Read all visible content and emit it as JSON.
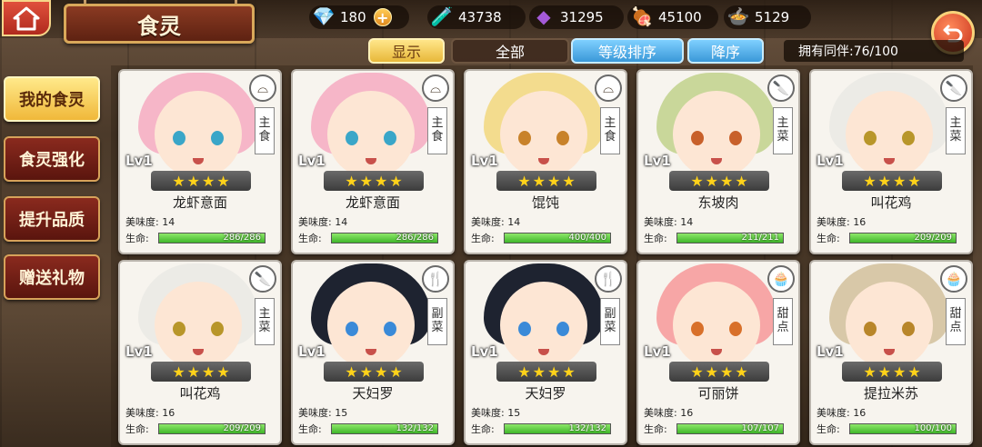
{
  "header": {
    "title": "食灵",
    "resources": [
      {
        "icon": "diamond-icon",
        "value": "180",
        "has_plus": true
      },
      {
        "icon": "potion-bottle-icon",
        "value": "43738",
        "has_plus": false
      },
      {
        "icon": "purple-gem-icon",
        "value": "31295",
        "has_plus": false
      },
      {
        "icon": "meat-icon",
        "value": "45100",
        "has_plus": false
      },
      {
        "icon": "cooking-pot-icon",
        "value": "5129",
        "has_plus": false
      }
    ]
  },
  "filters": {
    "show": "显示",
    "all": "全部",
    "sort": "等级排序",
    "order": "降序",
    "owned": "拥有同伴:76/100"
  },
  "sidebar": {
    "items": [
      {
        "label": "我的食灵",
        "active": true
      },
      {
        "label": "食灵强化",
        "active": false
      },
      {
        "label": "提升品质",
        "active": false
      },
      {
        "label": "赠送礼物",
        "active": false
      }
    ]
  },
  "labels": {
    "taste": "美味度:",
    "life": "生命:",
    "level": "Lv1"
  },
  "cards": [
    {
      "name": "龙虾意面",
      "category": [
        "主",
        "食"
      ],
      "badge": "bowl-icon",
      "taste": "14",
      "hp": "286/286",
      "hp_fraction": 1.0,
      "stars": 4,
      "hair": "#f6b6c8",
      "eye": "#3aa6c8"
    },
    {
      "name": "龙虾意面",
      "category": [
        "主",
        "食"
      ],
      "badge": "bowl-icon",
      "taste": "14",
      "hp": "286/286",
      "hp_fraction": 1.0,
      "stars": 4,
      "hair": "#f6b6c8",
      "eye": "#3aa6c8"
    },
    {
      "name": "馄饨",
      "category": [
        "主",
        "食"
      ],
      "badge": "bowl-icon",
      "taste": "14",
      "hp": "400/400",
      "hp_fraction": 1.0,
      "stars": 4,
      "hair": "#f3dc8e",
      "eye": "#c8822a"
    },
    {
      "name": "东坡肉",
      "category": [
        "主",
        "菜"
      ],
      "badge": "cleaver-icon",
      "taste": "14",
      "hp": "211/211",
      "hp_fraction": 1.0,
      "stars": 4,
      "hair": "#c9d79a",
      "eye": "#c8602a"
    },
    {
      "name": "叫花鸡",
      "category": [
        "主",
        "菜"
      ],
      "badge": "cleaver-icon",
      "taste": "16",
      "hp": "209/209",
      "hp_fraction": 1.0,
      "stars": 4,
      "hair": "#ecebe6",
      "eye": "#b8962a"
    },
    {
      "name": "叫花鸡",
      "category": [
        "主",
        "菜"
      ],
      "badge": "cleaver-icon",
      "taste": "16",
      "hp": "209/209",
      "hp_fraction": 1.0,
      "stars": 4,
      "hair": "#ecebe6",
      "eye": "#b8962a"
    },
    {
      "name": "天妇罗",
      "category": [
        "副",
        "菜"
      ],
      "badge": "fork-icon",
      "taste": "15",
      "hp": "132/132",
      "hp_fraction": 1.0,
      "stars": 4,
      "hair": "#1e2330",
      "eye": "#3a8ad8"
    },
    {
      "name": "天妇罗",
      "category": [
        "副",
        "菜"
      ],
      "badge": "fork-icon",
      "taste": "15",
      "hp": "132/132",
      "hp_fraction": 1.0,
      "stars": 4,
      "hair": "#1e2330",
      "eye": "#3a8ad8"
    },
    {
      "name": "可丽饼",
      "category": [
        "甜",
        "点"
      ],
      "badge": "cake-icon",
      "taste": "16",
      "hp": "107/107",
      "hp_fraction": 1.0,
      "stars": 4,
      "hair": "#f7a6a6",
      "eye": "#d8702a"
    },
    {
      "name": "提拉米苏",
      "category": [
        "甜",
        "点"
      ],
      "badge": "cake-icon",
      "taste": "16",
      "hp": "100/100",
      "hp_fraction": 1.0,
      "stars": 4,
      "hair": "#d8c8a8",
      "eye": "#b8862a"
    }
  ]
}
